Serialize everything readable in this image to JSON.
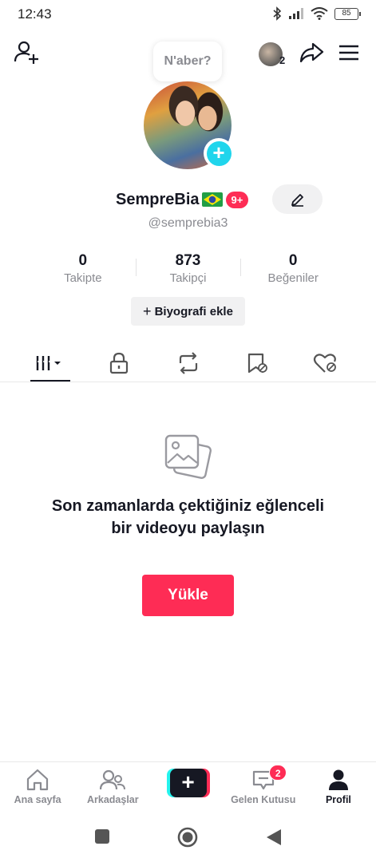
{
  "status_bar": {
    "time": "12:43",
    "battery": "85"
  },
  "header": {
    "bubble_text": "N'aber?",
    "account_count": "2"
  },
  "profile": {
    "username": "SempreBia",
    "notification_badge": "9+",
    "handle": "@semprebia3"
  },
  "stats": [
    {
      "value": "0",
      "label": "Takipte"
    },
    {
      "value": "873",
      "label": "Takipçi"
    },
    {
      "value": "0",
      "label": "Beğeniler"
    }
  ],
  "bio_button": {
    "plus": "+",
    "label": "Biyografi ekle"
  },
  "empty_state": {
    "message": "Son zamanlarda çektiğiniz eğlenceli bir videoyu paylaşın",
    "upload_label": "Yükle"
  },
  "bottom_nav": {
    "home": "Ana sayfa",
    "friends": "Arkadaşlar",
    "create": "+",
    "inbox": "Gelen Kutusu",
    "inbox_badge": "2",
    "profile": "Profil"
  },
  "colors": {
    "accent": "#fe2c55",
    "cyan": "#20d5ec",
    "text": "#161823",
    "muted": "#8a8b91"
  }
}
